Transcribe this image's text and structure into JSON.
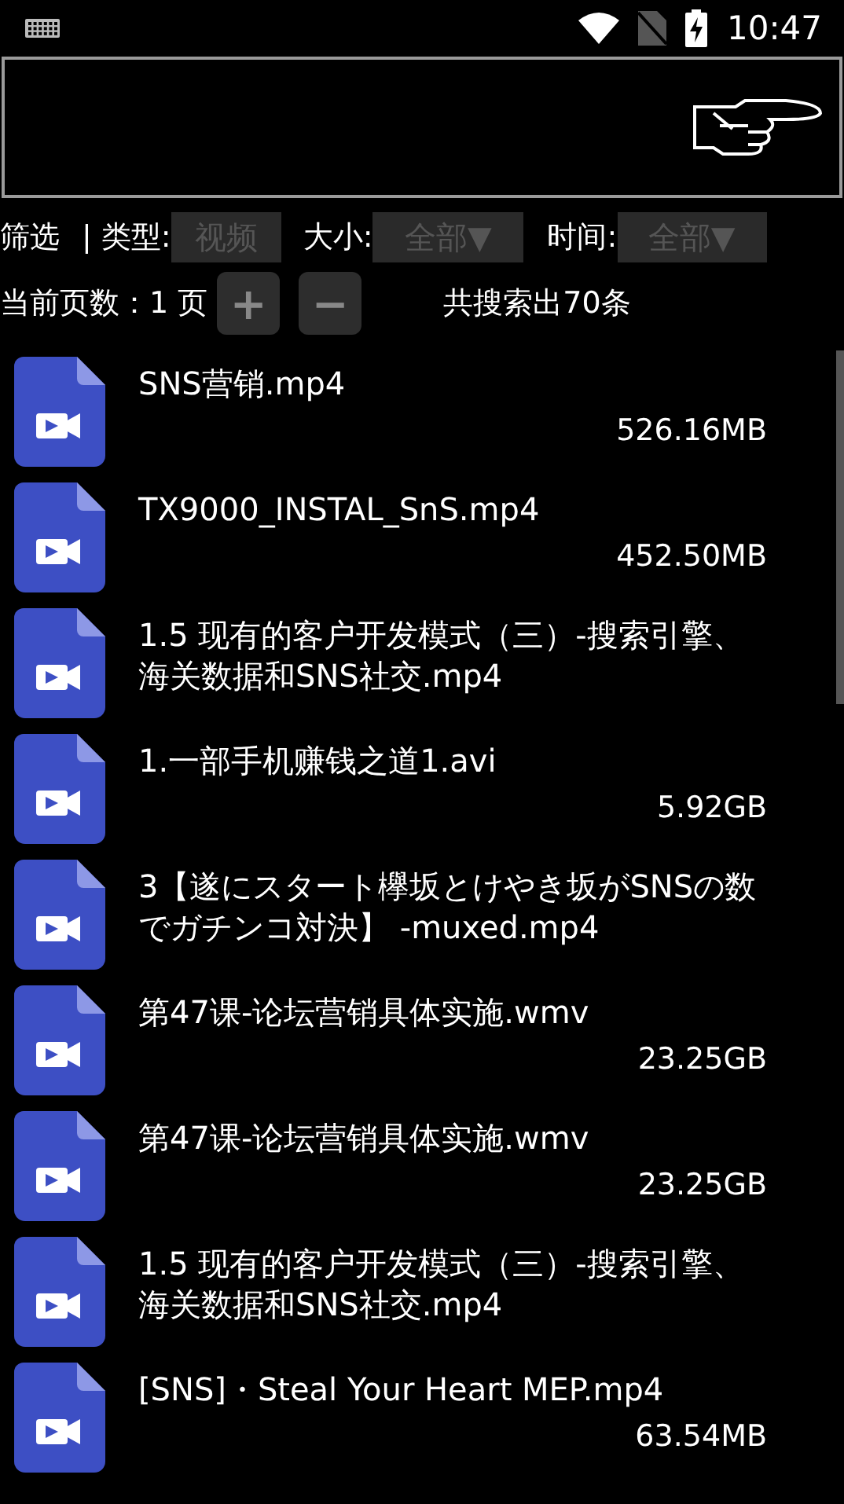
{
  "status_bar": {
    "time": "10:47"
  },
  "filter": {
    "label": "筛选",
    "separator": "|",
    "type_label": "类型:",
    "type_value": "视频",
    "size_label": "大小:",
    "size_value": "全部▼",
    "time_label": "时间:",
    "time_value": "全部▼"
  },
  "pager": {
    "label": "当前页数：1 页",
    "plus": "+",
    "minus": "−",
    "total": "共搜索出70条"
  },
  "files": [
    {
      "name": "SNS营销.mp4",
      "size": "526.16MB"
    },
    {
      "name": "TX9000_INSTAL_SnS.mp4",
      "size": "452.50MB"
    },
    {
      "name": "1.5 现有的客户开发模式（三）-搜索引擎、海关数据和SNS社交.mp4"
    },
    {
      "name": "1.一部手机赚钱之道1.avi",
      "size": "5.92GB"
    },
    {
      "name": "3【遂にスタート欅坂とけやき坂がSNSの数でガチンコ対決】 -muxed.mp4"
    },
    {
      "name": "第47课-论坛营销具体实施.wmv",
      "size": "23.25GB"
    },
    {
      "name": "第47课-论坛营销具体实施.wmv",
      "size": "23.25GB"
    },
    {
      "name": "1.5 现有的客户开发模式（三）-搜索引擎、海关数据和SNS社交.mp4"
    },
    {
      "name": "[SNS]・Steal Your Heart MEP.mp4",
      "size": "63.54MB"
    }
  ]
}
